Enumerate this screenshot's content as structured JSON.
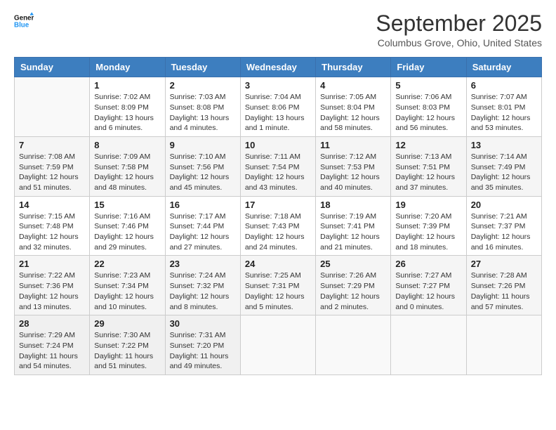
{
  "logo": {
    "line1": "General",
    "line2": "Blue"
  },
  "title": "September 2025",
  "subtitle": "Columbus Grove, Ohio, United States",
  "days": [
    "Sunday",
    "Monday",
    "Tuesday",
    "Wednesday",
    "Thursday",
    "Friday",
    "Saturday"
  ],
  "weeks": [
    [
      {
        "day": "",
        "data": ""
      },
      {
        "day": "1",
        "sunrise": "Sunrise: 7:02 AM",
        "sunset": "Sunset: 8:09 PM",
        "daylight": "Daylight: 13 hours and 6 minutes."
      },
      {
        "day": "2",
        "sunrise": "Sunrise: 7:03 AM",
        "sunset": "Sunset: 8:08 PM",
        "daylight": "Daylight: 13 hours and 4 minutes."
      },
      {
        "day": "3",
        "sunrise": "Sunrise: 7:04 AM",
        "sunset": "Sunset: 8:06 PM",
        "daylight": "Daylight: 13 hours and 1 minute."
      },
      {
        "day": "4",
        "sunrise": "Sunrise: 7:05 AM",
        "sunset": "Sunset: 8:04 PM",
        "daylight": "Daylight: 12 hours and 58 minutes."
      },
      {
        "day": "5",
        "sunrise": "Sunrise: 7:06 AM",
        "sunset": "Sunset: 8:03 PM",
        "daylight": "Daylight: 12 hours and 56 minutes."
      },
      {
        "day": "6",
        "sunrise": "Sunrise: 7:07 AM",
        "sunset": "Sunset: 8:01 PM",
        "daylight": "Daylight: 12 hours and 53 minutes."
      }
    ],
    [
      {
        "day": "7",
        "sunrise": "Sunrise: 7:08 AM",
        "sunset": "Sunset: 7:59 PM",
        "daylight": "Daylight: 12 hours and 51 minutes."
      },
      {
        "day": "8",
        "sunrise": "Sunrise: 7:09 AM",
        "sunset": "Sunset: 7:58 PM",
        "daylight": "Daylight: 12 hours and 48 minutes."
      },
      {
        "day": "9",
        "sunrise": "Sunrise: 7:10 AM",
        "sunset": "Sunset: 7:56 PM",
        "daylight": "Daylight: 12 hours and 45 minutes."
      },
      {
        "day": "10",
        "sunrise": "Sunrise: 7:11 AM",
        "sunset": "Sunset: 7:54 PM",
        "daylight": "Daylight: 12 hours and 43 minutes."
      },
      {
        "day": "11",
        "sunrise": "Sunrise: 7:12 AM",
        "sunset": "Sunset: 7:53 PM",
        "daylight": "Daylight: 12 hours and 40 minutes."
      },
      {
        "day": "12",
        "sunrise": "Sunrise: 7:13 AM",
        "sunset": "Sunset: 7:51 PM",
        "daylight": "Daylight: 12 hours and 37 minutes."
      },
      {
        "day": "13",
        "sunrise": "Sunrise: 7:14 AM",
        "sunset": "Sunset: 7:49 PM",
        "daylight": "Daylight: 12 hours and 35 minutes."
      }
    ],
    [
      {
        "day": "14",
        "sunrise": "Sunrise: 7:15 AM",
        "sunset": "Sunset: 7:48 PM",
        "daylight": "Daylight: 12 hours and 32 minutes."
      },
      {
        "day": "15",
        "sunrise": "Sunrise: 7:16 AM",
        "sunset": "Sunset: 7:46 PM",
        "daylight": "Daylight: 12 hours and 29 minutes."
      },
      {
        "day": "16",
        "sunrise": "Sunrise: 7:17 AM",
        "sunset": "Sunset: 7:44 PM",
        "daylight": "Daylight: 12 hours and 27 minutes."
      },
      {
        "day": "17",
        "sunrise": "Sunrise: 7:18 AM",
        "sunset": "Sunset: 7:43 PM",
        "daylight": "Daylight: 12 hours and 24 minutes."
      },
      {
        "day": "18",
        "sunrise": "Sunrise: 7:19 AM",
        "sunset": "Sunset: 7:41 PM",
        "daylight": "Daylight: 12 hours and 21 minutes."
      },
      {
        "day": "19",
        "sunrise": "Sunrise: 7:20 AM",
        "sunset": "Sunset: 7:39 PM",
        "daylight": "Daylight: 12 hours and 18 minutes."
      },
      {
        "day": "20",
        "sunrise": "Sunrise: 7:21 AM",
        "sunset": "Sunset: 7:37 PM",
        "daylight": "Daylight: 12 hours and 16 minutes."
      }
    ],
    [
      {
        "day": "21",
        "sunrise": "Sunrise: 7:22 AM",
        "sunset": "Sunset: 7:36 PM",
        "daylight": "Daylight: 12 hours and 13 minutes."
      },
      {
        "day": "22",
        "sunrise": "Sunrise: 7:23 AM",
        "sunset": "Sunset: 7:34 PM",
        "daylight": "Daylight: 12 hours and 10 minutes."
      },
      {
        "day": "23",
        "sunrise": "Sunrise: 7:24 AM",
        "sunset": "Sunset: 7:32 PM",
        "daylight": "Daylight: 12 hours and 8 minutes."
      },
      {
        "day": "24",
        "sunrise": "Sunrise: 7:25 AM",
        "sunset": "Sunset: 7:31 PM",
        "daylight": "Daylight: 12 hours and 5 minutes."
      },
      {
        "day": "25",
        "sunrise": "Sunrise: 7:26 AM",
        "sunset": "Sunset: 7:29 PM",
        "daylight": "Daylight: 12 hours and 2 minutes."
      },
      {
        "day": "26",
        "sunrise": "Sunrise: 7:27 AM",
        "sunset": "Sunset: 7:27 PM",
        "daylight": "Daylight: 12 hours and 0 minutes."
      },
      {
        "day": "27",
        "sunrise": "Sunrise: 7:28 AM",
        "sunset": "Sunset: 7:26 PM",
        "daylight": "Daylight: 11 hours and 57 minutes."
      }
    ],
    [
      {
        "day": "28",
        "sunrise": "Sunrise: 7:29 AM",
        "sunset": "Sunset: 7:24 PM",
        "daylight": "Daylight: 11 hours and 54 minutes."
      },
      {
        "day": "29",
        "sunrise": "Sunrise: 7:30 AM",
        "sunset": "Sunset: 7:22 PM",
        "daylight": "Daylight: 11 hours and 51 minutes."
      },
      {
        "day": "30",
        "sunrise": "Sunrise: 7:31 AM",
        "sunset": "Sunset: 7:20 PM",
        "daylight": "Daylight: 11 hours and 49 minutes."
      },
      {
        "day": "",
        "data": ""
      },
      {
        "day": "",
        "data": ""
      },
      {
        "day": "",
        "data": ""
      },
      {
        "day": "",
        "data": ""
      }
    ]
  ]
}
